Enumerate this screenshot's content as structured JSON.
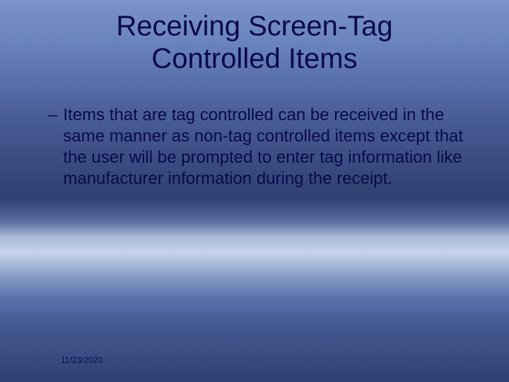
{
  "slide": {
    "title_line1": "Receiving Screen-Tag",
    "title_line2": "Controlled Items",
    "bullet_dash": "–",
    "body_text": "Items that are tag controlled can be received in the same manner as non-tag controlled items except that the user will be prompted to enter tag information like manufacturer information during the receipt.",
    "footer_date": "11/23/2020"
  }
}
